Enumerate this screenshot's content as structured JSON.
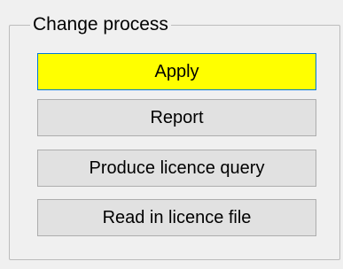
{
  "group": {
    "title": "Change process"
  },
  "buttons": {
    "apply": "Apply",
    "report": "Report",
    "licence_query": "Produce licence query",
    "read_licence": "Read in licence file"
  },
  "colors": {
    "apply_background": "#ffff00",
    "window_background": "#f0f0f0",
    "button_background": "#e1e1e1"
  }
}
